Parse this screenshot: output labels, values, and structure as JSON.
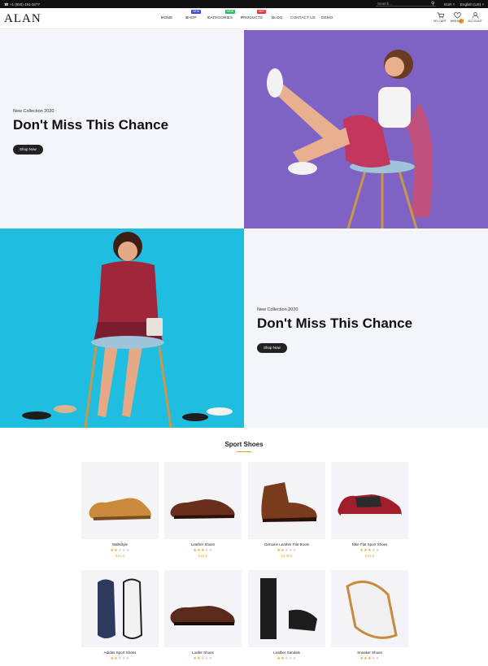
{
  "topbar": {
    "phone": "+1 (650) 491-3277",
    "search_placeholder": "Search...",
    "currency": "EUR",
    "language": "English (US)"
  },
  "header": {
    "logo": "ALAN",
    "nav": [
      {
        "label": "HOME",
        "chevron": true
      },
      {
        "label": "SHOP",
        "chevron": true,
        "badge": "NEW",
        "badge_color": "#3b47e0"
      },
      {
        "label": "CATEGORIES",
        "chevron": true,
        "badge": "NEW",
        "badge_color": "#2ebd59"
      },
      {
        "label": "PRODUCTS",
        "chevron": true,
        "badge": "HOT",
        "badge_color": "#e53935"
      },
      {
        "label": "BLOG",
        "chevron": false
      },
      {
        "label": "CONTACT US",
        "chevron": false
      },
      {
        "label": "DEMO",
        "chevron": false
      }
    ],
    "icons": {
      "cart_label": "MY CART",
      "wishlist_label": "WISHLIST",
      "account_label": "ACCOUNT",
      "cart_count": "0"
    }
  },
  "hero1": {
    "subtitle": "New Collection 2020",
    "title": "Don't Miss This Chance",
    "button": "Shop Now",
    "image_bg": "#7e62c4"
  },
  "hero2": {
    "subtitle": "New Collection 2020",
    "title": "Don't Miss This Chance",
    "button": "Shop Now",
    "image_bg": "#1fbde0"
  },
  "section": {
    "title": "Sport Shoes",
    "accent": "#f0a02a"
  },
  "products": [
    {
      "name": "Walkstyle",
      "rating": 2,
      "price": "9.54 €"
    },
    {
      "name": "Leather Shoes",
      "rating": 3,
      "price": "9.81 €"
    },
    {
      "name": "Genuine Leather Flat Boots",
      "rating": 2,
      "price": "19.35 €"
    },
    {
      "name": "Nike Flat Sport Shoes",
      "rating": 3,
      "price": "9.81 €"
    },
    {
      "name": "Adidas Sport Shoes",
      "rating": 2,
      "price": ""
    },
    {
      "name": "Loafer Shoes",
      "rating": 2,
      "price": ""
    },
    {
      "name": "Leather Sandals",
      "rating": 2,
      "price": ""
    },
    {
      "name": "Sneaker Shoes",
      "rating": 3,
      "price": ""
    }
  ]
}
